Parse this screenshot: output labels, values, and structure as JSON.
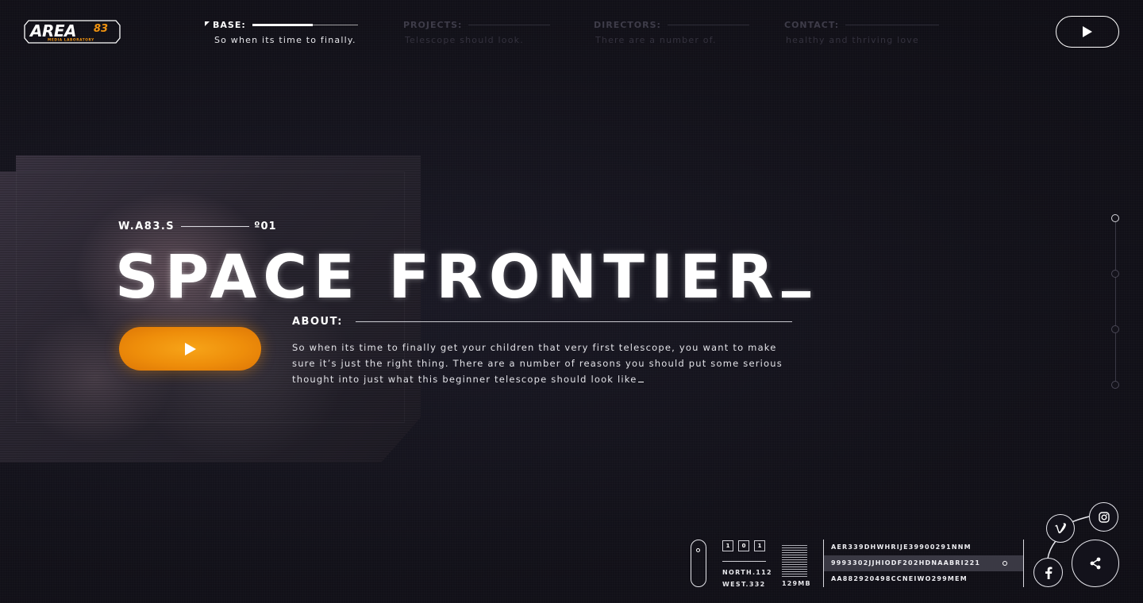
{
  "brand": {
    "logo_text": "AREA",
    "logo_number": "83",
    "logo_tagline": "MEDIA LABORATORY",
    "accent": "#f29410"
  },
  "nav": [
    {
      "label": "BASE:",
      "sub": "So when its time to finally.",
      "active": true
    },
    {
      "label": "PROJECTS:",
      "sub": "Telescope should look.",
      "active": false
    },
    {
      "label": "DIRECTORS:",
      "sub": "There are a number of.",
      "active": false
    },
    {
      "label": "CONTACT:",
      "sub": "healthy and thriving love",
      "active": false
    }
  ],
  "header": {
    "play_icon": "play-icon"
  },
  "hero": {
    "code": "W.A83.S",
    "index": "º01",
    "title": "SPACE FRONTIER",
    "cta_icon": "play-icon"
  },
  "about": {
    "label": "ABOUT:",
    "text": "So when its time to finally get your children that very first telescope, you want to make sure it’s just the right thing. There are a number of reasons you should put some serious thought into just what this beginner telescope should look like"
  },
  "pager": {
    "count": 4,
    "active_index": 0
  },
  "hud": {
    "digits": [
      "1",
      "0",
      "1"
    ],
    "north": "NORTH.112",
    "west": "WEST.332",
    "memory": "129MB",
    "codes": [
      "AER339DHWHRIJE39900291NNM",
      "9993302JJHIODF202HDNAABRI221",
      "AA882920498CCNEIWO299MEM"
    ],
    "highlighted_code_index": 1
  },
  "social": {
    "main_icon": "share-icon",
    "items": [
      "vimeo-icon",
      "instagram-icon",
      "facebook-icon"
    ]
  }
}
